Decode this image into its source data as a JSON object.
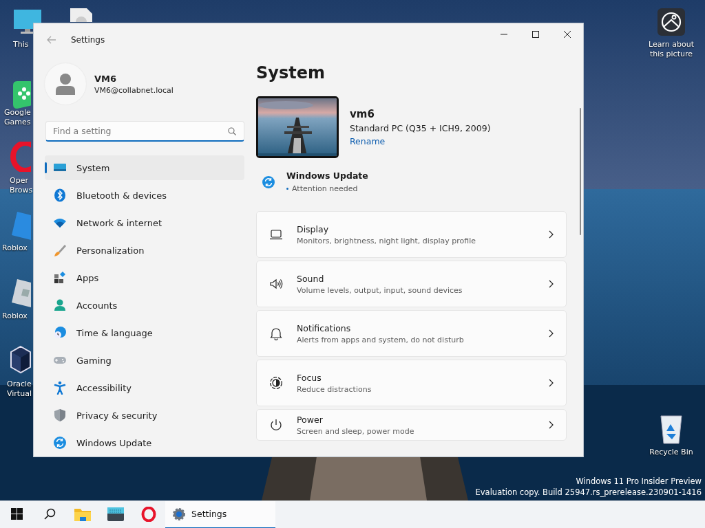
{
  "desktop": {
    "icons": [
      {
        "kind": "computer",
        "lines": [
          "This"
        ]
      },
      {
        "kind": "document"
      },
      {
        "kind": "info",
        "lines": [
          "Learn about",
          "this picture"
        ]
      },
      {
        "kind": "games",
        "lines": [
          "Google",
          "Games"
        ]
      },
      {
        "kind": "browser",
        "lines": [
          "Oper",
          "Brows"
        ]
      },
      {
        "kind": "studio",
        "lines": [
          "Roblox"
        ]
      },
      {
        "kind": "player",
        "lines": [
          "Roblox"
        ]
      },
      {
        "kind": "virtualbox",
        "lines": [
          "Oracle",
          "Virtual"
        ]
      },
      {
        "kind": "bin",
        "lines": [
          "Recycle Bin"
        ]
      }
    ],
    "watermark": [
      "Windows 11 Pro Insider Preview",
      "Evaluation copy. Build 25947.rs_prerelease.230901-1416"
    ]
  },
  "window": {
    "title": "Settings",
    "profile": {
      "name": "VM6",
      "email": "VM6@collabnet.local"
    },
    "search": {
      "placeholder": "Find a setting"
    },
    "nav": [
      {
        "label": "System",
        "selected": true
      },
      {
        "label": "Bluetooth & devices",
        "selected": false
      },
      {
        "label": "Network & internet",
        "selected": false
      },
      {
        "label": "Personalization",
        "selected": false
      },
      {
        "label": "Apps",
        "selected": false
      },
      {
        "label": "Accounts",
        "selected": false
      },
      {
        "label": "Time & language",
        "selected": false
      },
      {
        "label": "Gaming",
        "selected": false
      },
      {
        "label": "Accessibility",
        "selected": false
      },
      {
        "label": "Privacy & security",
        "selected": false
      },
      {
        "label": "Windows Update",
        "selected": false
      }
    ],
    "page_title": "System",
    "device": {
      "name": "vm6",
      "model": "Standard PC (Q35 + ICH9, 2009)",
      "action": "Rename"
    },
    "update": {
      "title": "Windows Update",
      "status": "Attention needed"
    },
    "cards": [
      {
        "title": "Display",
        "subtitle": "Monitors, brightness, night light, display profile"
      },
      {
        "title": "Sound",
        "subtitle": "Volume levels, output, input, sound devices"
      },
      {
        "title": "Notifications",
        "subtitle": "Alerts from apps and system, do not disturb"
      },
      {
        "title": "Focus",
        "subtitle": "Reduce distractions"
      },
      {
        "title": "Power",
        "subtitle": "Screen and sleep, power mode"
      }
    ]
  },
  "taskbar": {
    "items": [
      {
        "kind": "start",
        "selected": false
      },
      {
        "kind": "search",
        "selected": false
      },
      {
        "kind": "folder",
        "selected": false
      },
      {
        "kind": "terminal",
        "selected": false
      },
      {
        "kind": "opera",
        "selected": false
      },
      {
        "kind": "settings",
        "label": "Settings",
        "selected": true
      }
    ]
  }
}
